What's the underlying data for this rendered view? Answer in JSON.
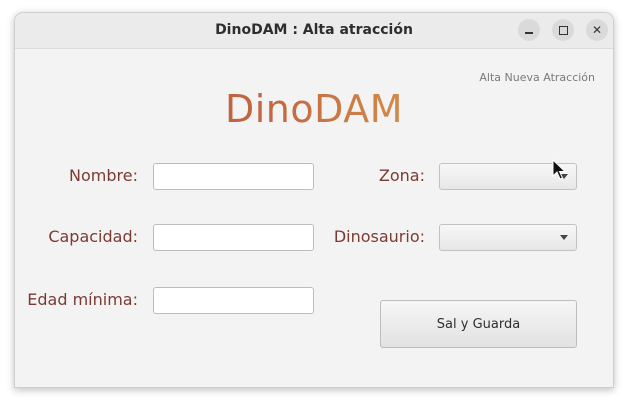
{
  "window": {
    "title": "DinoDAM : Alta atracción",
    "controls": [
      "minimize-icon",
      "maximize-icon",
      "close-icon"
    ]
  },
  "header": {
    "subtitle": "Alta Nueva Atracción",
    "logo": "DinoDAM"
  },
  "form": {
    "nombre_label": "Nombre:",
    "nombre_value": "",
    "capacidad_label": "Capacidad:",
    "capacidad_value": "",
    "edad_label": "Edad mínima:",
    "edad_value": "",
    "zona_label": "Zona:",
    "zona_value": "",
    "dinosaurio_label": "Dinosaurio:",
    "dinosaurio_value": "",
    "save_label": "Sal y Guarda"
  },
  "colors": {
    "label": "#7a3b32",
    "logo_start": "#a44a3d",
    "logo_mid": "#d89a4e"
  }
}
